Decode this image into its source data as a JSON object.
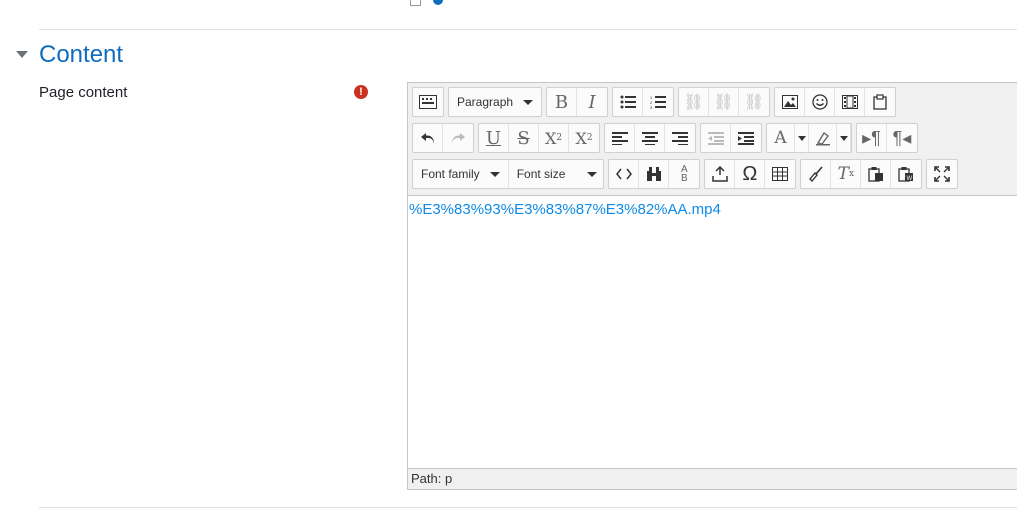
{
  "section": {
    "title": "Content"
  },
  "field": {
    "label": "Page content"
  },
  "toolbar": {
    "block_format": "Paragraph",
    "font_family": "Font family",
    "font_size": "Font size"
  },
  "editor": {
    "content_link": "%E3%83%93%E3%83%87%E3%82%AA.mp4",
    "path": "Path: p"
  },
  "colors": {
    "accent": "#0f6cbf",
    "required": "#ca3120",
    "link": "#0f8ae6"
  }
}
